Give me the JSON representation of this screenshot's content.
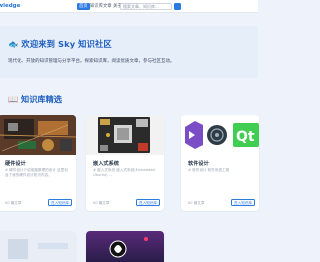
{
  "navbar": {
    "brand": "wledge",
    "items": [
      {
        "label": "首页",
        "active": true
      },
      {
        "label": "知识库",
        "active": false
      },
      {
        "label": "文章",
        "active": false
      },
      {
        "label": "关于",
        "active": false
      }
    ],
    "search_placeholder": "搜索文章、知识库..."
  },
  "hero": {
    "title": "🐟 欢迎来到 Sky 知识社区",
    "subtitle": "现代化、开放的知识管理与分享平台。探索知识库，阅读优质文章，参与社区互动。"
  },
  "section": {
    "title": "📖 知识库精选"
  },
  "cards": [
    {
      "title": "硬件设计",
      "desc": "# 硬件设计介绍电路原理的设计 这里包含了我的硬件设计知识内容。",
      "meta": "00 篇文章",
      "button": "进入知识库"
    },
    {
      "title": "嵌入式系统",
      "desc": "# 嵌入式系统 嵌入式系统(Embedded Ubuntu) ...",
      "meta": "00 篇文章",
      "button": "进入知识库"
    },
    {
      "title": "软件设计",
      "desc": "# 软件设计 软件系统工程",
      "meta": "00 篇文章",
      "button": "进入知识库"
    }
  ],
  "colors": {
    "accent": "#2a7ae2",
    "title_blue": "#1f5fbf",
    "page_bg": "#eef3fb"
  }
}
